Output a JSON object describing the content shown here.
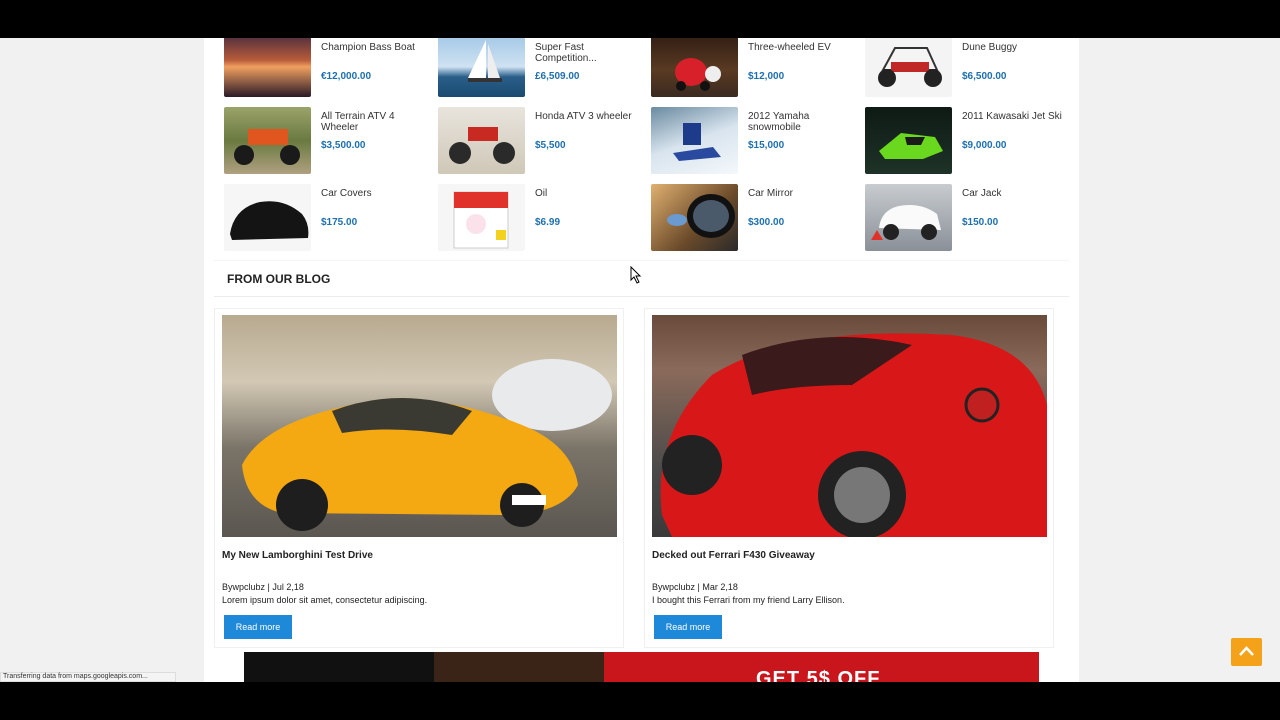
{
  "products": [
    {
      "name": "Champion Bass Boat",
      "price": "€12,000.00",
      "icon": "boat-sunset-image"
    },
    {
      "name": "Super Fast Competition...",
      "price": "£6,509.00",
      "icon": "sailboat-image"
    },
    {
      "name": "Three-wheeled EV",
      "price": "$12,000",
      "icon": "ev-image"
    },
    {
      "name": "Dune Buggy",
      "price": "$6,500.00",
      "icon": "dune-buggy-image"
    },
    {
      "name": "All Terrain ATV 4 Wheeler",
      "price": "$3,500.00",
      "icon": "atv-image"
    },
    {
      "name": "Honda ATV 3 wheeler",
      "price": "$5,500",
      "icon": "honda-atv-image"
    },
    {
      "name": "2012 Yamaha snowmobile",
      "price": "$15,000",
      "icon": "snowmobile-image"
    },
    {
      "name": "2011 Kawasaki Jet Ski",
      "price": "$9,000.00",
      "icon": "jet-ski-image"
    },
    {
      "name": "Car Covers",
      "price": "$175.00",
      "icon": "car-cover-image"
    },
    {
      "name": "Oil",
      "price": "$6.99",
      "icon": "oil-can-image"
    },
    {
      "name": "Car Mirror",
      "price": "$300.00",
      "icon": "car-mirror-image"
    },
    {
      "name": "Car Jack",
      "price": "$150.00",
      "icon": "car-jack-image"
    }
  ],
  "blog": {
    "heading": "FROM OUR BLOG",
    "posts": [
      {
        "title": "My New Lamborghini Test Drive",
        "meta": "Bywpclubz | Jul 2,18",
        "excerpt": "Lorem ipsum dolor sit amet, consectetur adipiscing.",
        "button": "Read more"
      },
      {
        "title": "Decked out Ferrari F430 Giveaway",
        "meta": "Bywpclubz | Mar 2,18",
        "excerpt": "I bought this Ferrari from my friend Larry Ellison.",
        "button": "Read more"
      }
    ]
  },
  "banner": {
    "offer": "GET 5$ OFF"
  },
  "status": {
    "text": "Transferring data from maps.googleapis.com..."
  },
  "colors": {
    "price": "#1e6fae",
    "button": "#1e88d9",
    "scroll_top": "#f4a21a"
  }
}
